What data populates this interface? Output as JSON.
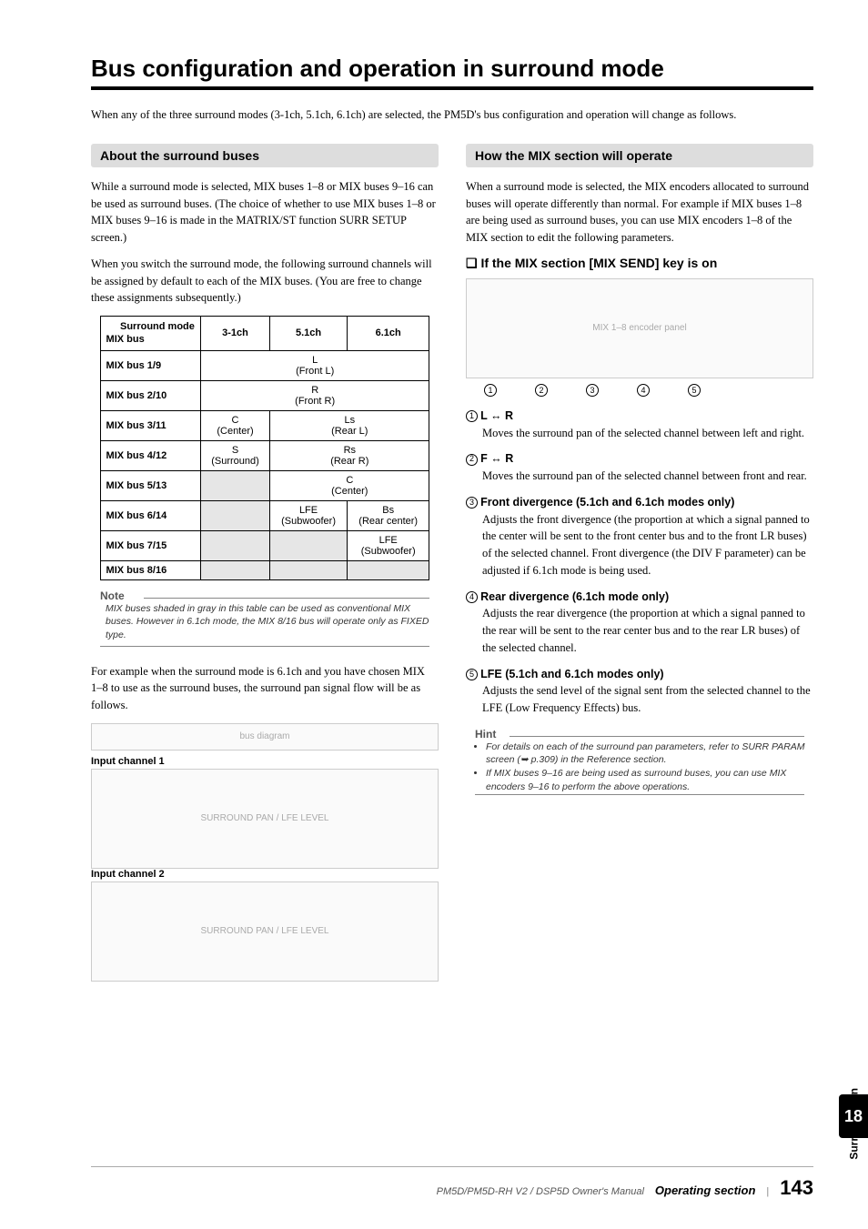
{
  "pageTitle": "Bus configuration and operation in surround mode",
  "intro": "When any of the three surround modes (3-1ch, 5.1ch, 6.1ch) are selected, the PM5D's bus configuration and operation will change as follows.",
  "left": {
    "sectionTitle": "About the surround buses",
    "para1": "While a surround mode is selected, MIX buses 1–8 or MIX buses 9–16 can be used as surround buses. (The choice of whether to use MIX buses 1–8 or MIX buses 9–16 is made in the MATRIX/ST function SURR SETUP screen.)",
    "para2": "When you switch the surround mode, the following surround channels will be assigned by default to each of the MIX buses. (You are free to change these assignments subsequently.)",
    "table": {
      "diagTop": "Surround mode",
      "diagBottom": "MIX bus",
      "cols": [
        "3-1ch",
        "5.1ch",
        "6.1ch"
      ],
      "rows": [
        {
          "h": "MIX bus 1/9",
          "c": [
            {
              "t": "L\n(Front L)",
              "span": 3
            }
          ]
        },
        {
          "h": "MIX bus 2/10",
          "c": [
            {
              "t": "R\n(Front R)",
              "span": 3
            }
          ]
        },
        {
          "h": "MIX bus 3/11",
          "c": [
            {
              "t": "C\n(Center)",
              "span": 1
            },
            {
              "t": "Ls\n(Rear L)",
              "span": 2
            }
          ]
        },
        {
          "h": "MIX bus 4/12",
          "c": [
            {
              "t": "S\n(Surround)",
              "span": 1
            },
            {
              "t": "Rs\n(Rear R)",
              "span": 2
            }
          ]
        },
        {
          "h": "MIX bus 5/13",
          "c": [
            {
              "t": "",
              "span": 1,
              "g": true
            },
            {
              "t": "C\n(Center)",
              "span": 2
            }
          ]
        },
        {
          "h": "MIX bus 6/14",
          "c": [
            {
              "t": "",
              "span": 1,
              "g": true
            },
            {
              "t": "LFE\n(Subwoofer)",
              "span": 1
            },
            {
              "t": "Bs\n(Rear center)",
              "span": 1
            }
          ]
        },
        {
          "h": "MIX bus 7/15",
          "c": [
            {
              "t": "",
              "span": 1,
              "g": true
            },
            {
              "t": "",
              "span": 1,
              "g": true
            },
            {
              "t": "LFE\n(Subwoofer)",
              "span": 1
            }
          ]
        },
        {
          "h": "MIX bus 8/16",
          "c": [
            {
              "t": "",
              "span": 1,
              "g": true
            },
            {
              "t": "",
              "span": 1,
              "g": true
            },
            {
              "t": "",
              "span": 1,
              "g": true
            }
          ]
        }
      ]
    },
    "noteLabel": "Note",
    "noteText": "MIX buses shaded in gray in this table can be used as conventional MIX buses. However in 6.1ch mode, the MIX 8/16 bus will operate only as FIXED type.",
    "para3": "For example when the surround mode is 6.1ch and you have chosen MIX 1–8 to use as the surround buses, the surround pan signal flow will be as follows.",
    "diag1Label": "Input channel 1",
    "diag2Label": "Input channel 2"
  },
  "right": {
    "sectionTitle": "How the MIX section will operate",
    "para1": "When a surround mode is selected, the MIX encoders allocated to surround buses will operate differently than normal. For example if MIX buses 1–8 are being used as surround buses, you can use MIX encoders 1–8 of the MIX section to edit the following parameters.",
    "subhead": "❏ If the MIX section [MIX SEND] key is on",
    "params": [
      {
        "n": "1",
        "title": "L ↔ R",
        "body": "Moves the surround pan of the selected channel between left and right."
      },
      {
        "n": "2",
        "title": "F ↔ R",
        "body": "Moves the surround pan of the selected channel between front and rear."
      },
      {
        "n": "3",
        "title": "Front divergence (5.1ch and 6.1ch modes only)",
        "body": "Adjusts the front divergence (the proportion at which a signal panned to the center will be sent to the front center bus and to the front LR buses) of the selected channel. Front divergence (the DIV F parameter) can be adjusted if 6.1ch mode is being used."
      },
      {
        "n": "4",
        "title": "Rear divergence (6.1ch mode only)",
        "body": "Adjusts the rear divergence (the proportion at which a signal panned to the rear will be sent to the rear center bus and to the rear LR buses) of the selected channel."
      },
      {
        "n": "5",
        "title": "LFE (5.1ch and 6.1ch modes only)",
        "body": "Adjusts the send level of the signal sent from the selected channel to the LFE (Low Frequency Effects) bus."
      }
    ],
    "hintLabel": "Hint",
    "hints": [
      "For details on each of the surround pan parameters, refer to SURR PARAM screen (➥ p.309) in the Reference section.",
      "If MIX buses 9–16 are being used as surround buses, you can use MIX encoders 9–16 to perform the above operations."
    ]
  },
  "sideLabel": "Surround pan",
  "chapterNum": "18",
  "footer": {
    "manual": "PM5D/PM5D-RH V2 / DSP5D Owner's Manual",
    "section": "Operating section",
    "page": "143"
  }
}
